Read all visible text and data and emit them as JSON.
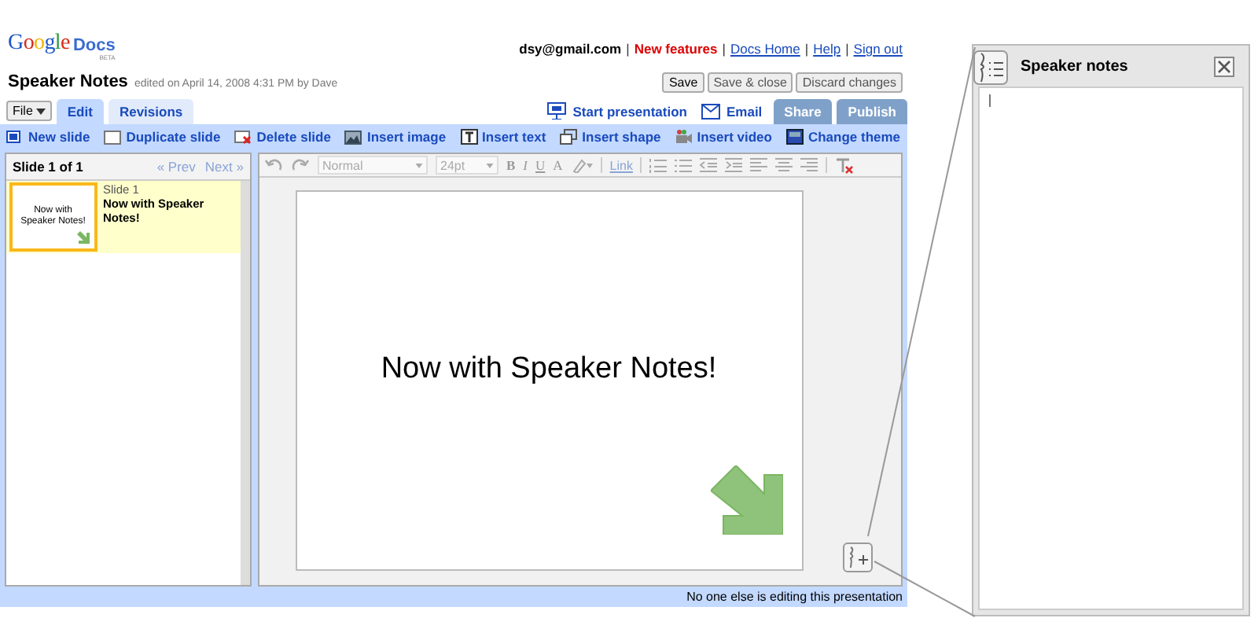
{
  "header": {
    "logo": "Google",
    "product": "Docs",
    "badge": "BETA",
    "user_links": [
      {
        "label": "dsy@gmail.com",
        "kind": "plain"
      },
      {
        "label": "|",
        "kind": "sep"
      },
      {
        "label": "New features",
        "kind": "highlight"
      },
      {
        "label": "|",
        "kind": "sep"
      },
      {
        "label": "Docs Home",
        "kind": "link"
      },
      {
        "label": "|",
        "kind": "sep"
      },
      {
        "label": "Help",
        "kind": "link"
      },
      {
        "label": "|",
        "kind": "sep"
      },
      {
        "label": "Sign out",
        "kind": "link"
      }
    ]
  },
  "document": {
    "title": "Speaker Notes",
    "edited": "edited on April 14, 2008 4:31 PM by  Dave"
  },
  "doc_buttons": [
    "Save",
    "Save & close",
    "Discard changes"
  ],
  "file_menu": "File",
  "tabs": [
    {
      "label": "Edit",
      "selected": true
    },
    {
      "label": "Revisions",
      "selected": false
    }
  ],
  "actions": [
    "Start presentation",
    "Email"
  ],
  "share_buttons": [
    "Share",
    "Publish"
  ],
  "toolbar": [
    "New slide",
    "Duplicate slide",
    "Delete slide",
    "Insert image",
    "Insert text",
    "Insert shape",
    "Insert video",
    "Change theme"
  ],
  "slide_panel": {
    "heading": "Slide 1 of 1",
    "prev": "« Prev",
    "next": "Next »",
    "slides": [
      {
        "number": "Slide 1",
        "title": "Now with Speaker Notes!",
        "thumb_text": "Now with Speaker Notes!",
        "selected": true
      }
    ]
  },
  "format_toolbar": {
    "style": "Normal",
    "size": "24pt",
    "bold": "B",
    "italic": "I",
    "underline": "U",
    "text_color": "A",
    "link": "Link"
  },
  "slide": {
    "text": "Now with Speaker Notes!"
  },
  "status": "No one else is editing this presentation",
  "notes_panel": {
    "title": "Speaker notes"
  }
}
